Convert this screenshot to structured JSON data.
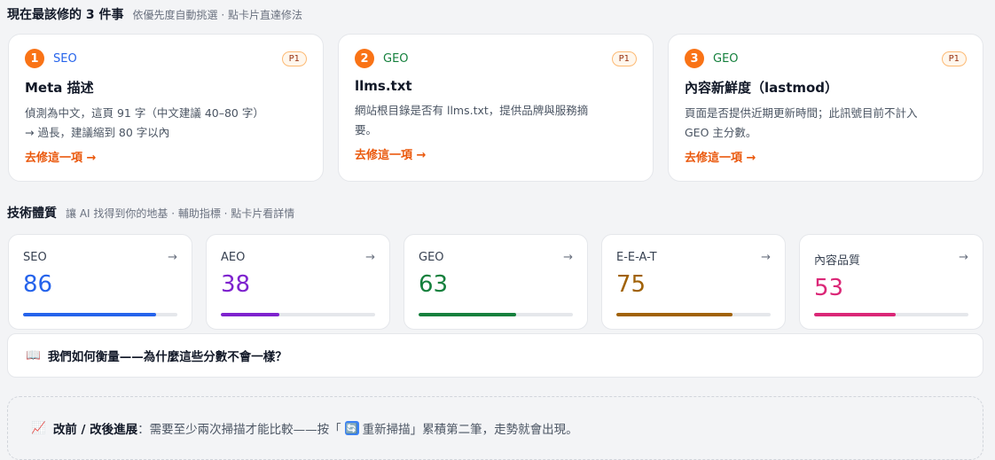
{
  "top_fixes": {
    "title": "現在最該修的 3 件事",
    "subtitle": "依優先度自動挑選 · 點卡片直達修法",
    "items": [
      {
        "num": "1",
        "category": "SEO",
        "priority": "P1",
        "name": "Meta 描述",
        "desc_line1": "偵測為中文，這頁 91 字（中文建議 40–80 字）",
        "desc_line2": "→ 過長，建議縮到 80 字以內",
        "link": "去修這一項 →"
      },
      {
        "num": "2",
        "category": "GEO",
        "priority": "P1",
        "name": "llms.txt",
        "desc_line1": "網站根目錄是否有 llms.txt，提供品牌與服務摘",
        "desc_line2": "要。",
        "link": "去修這一項 →"
      },
      {
        "num": "3",
        "category": "GEO",
        "priority": "P1",
        "name": "內容新鮮度（lastmod）",
        "desc_line1": "頁面是否提供近期更新時間；此訊號目前不計入",
        "desc_line2": "GEO 主分數。",
        "link": "去修這一項 →"
      }
    ]
  },
  "tech_health": {
    "title": "技術體質",
    "subtitle": "讓 AI 找得到你的地基 · 輔助指標 · 點卡片看詳情",
    "scores": [
      {
        "label": "SEO",
        "value": "86",
        "percent": 86,
        "color": "#2563eb"
      },
      {
        "label": "AEO",
        "value": "38",
        "percent": 38,
        "color": "#7e22ce"
      },
      {
        "label": "GEO",
        "value": "63",
        "percent": 63,
        "color": "#15803d"
      },
      {
        "label": "E-E-A-T",
        "value": "75",
        "percent": 75,
        "color": "#a16207"
      },
      {
        "label": "內容品質",
        "value": "53",
        "percent": 53,
        "color": "#db2777"
      }
    ],
    "arrow": "→"
  },
  "howto": {
    "icon": "📖",
    "label": "我們如何衡量——為什麼這些分數不會一樣？"
  },
  "progress": {
    "icon": "📈",
    "title": "改前 / 改後進展",
    "text_before": "：需要至少兩次掃描才能比較——按「",
    "refresh_icon": "🔄",
    "text_after": " 重新掃描」累積第二筆，走勢就會出現。"
  },
  "colors": {
    "seo_category": "#2563eb",
    "geo_category": "#15803d",
    "accent_orange": "#ea580c"
  }
}
